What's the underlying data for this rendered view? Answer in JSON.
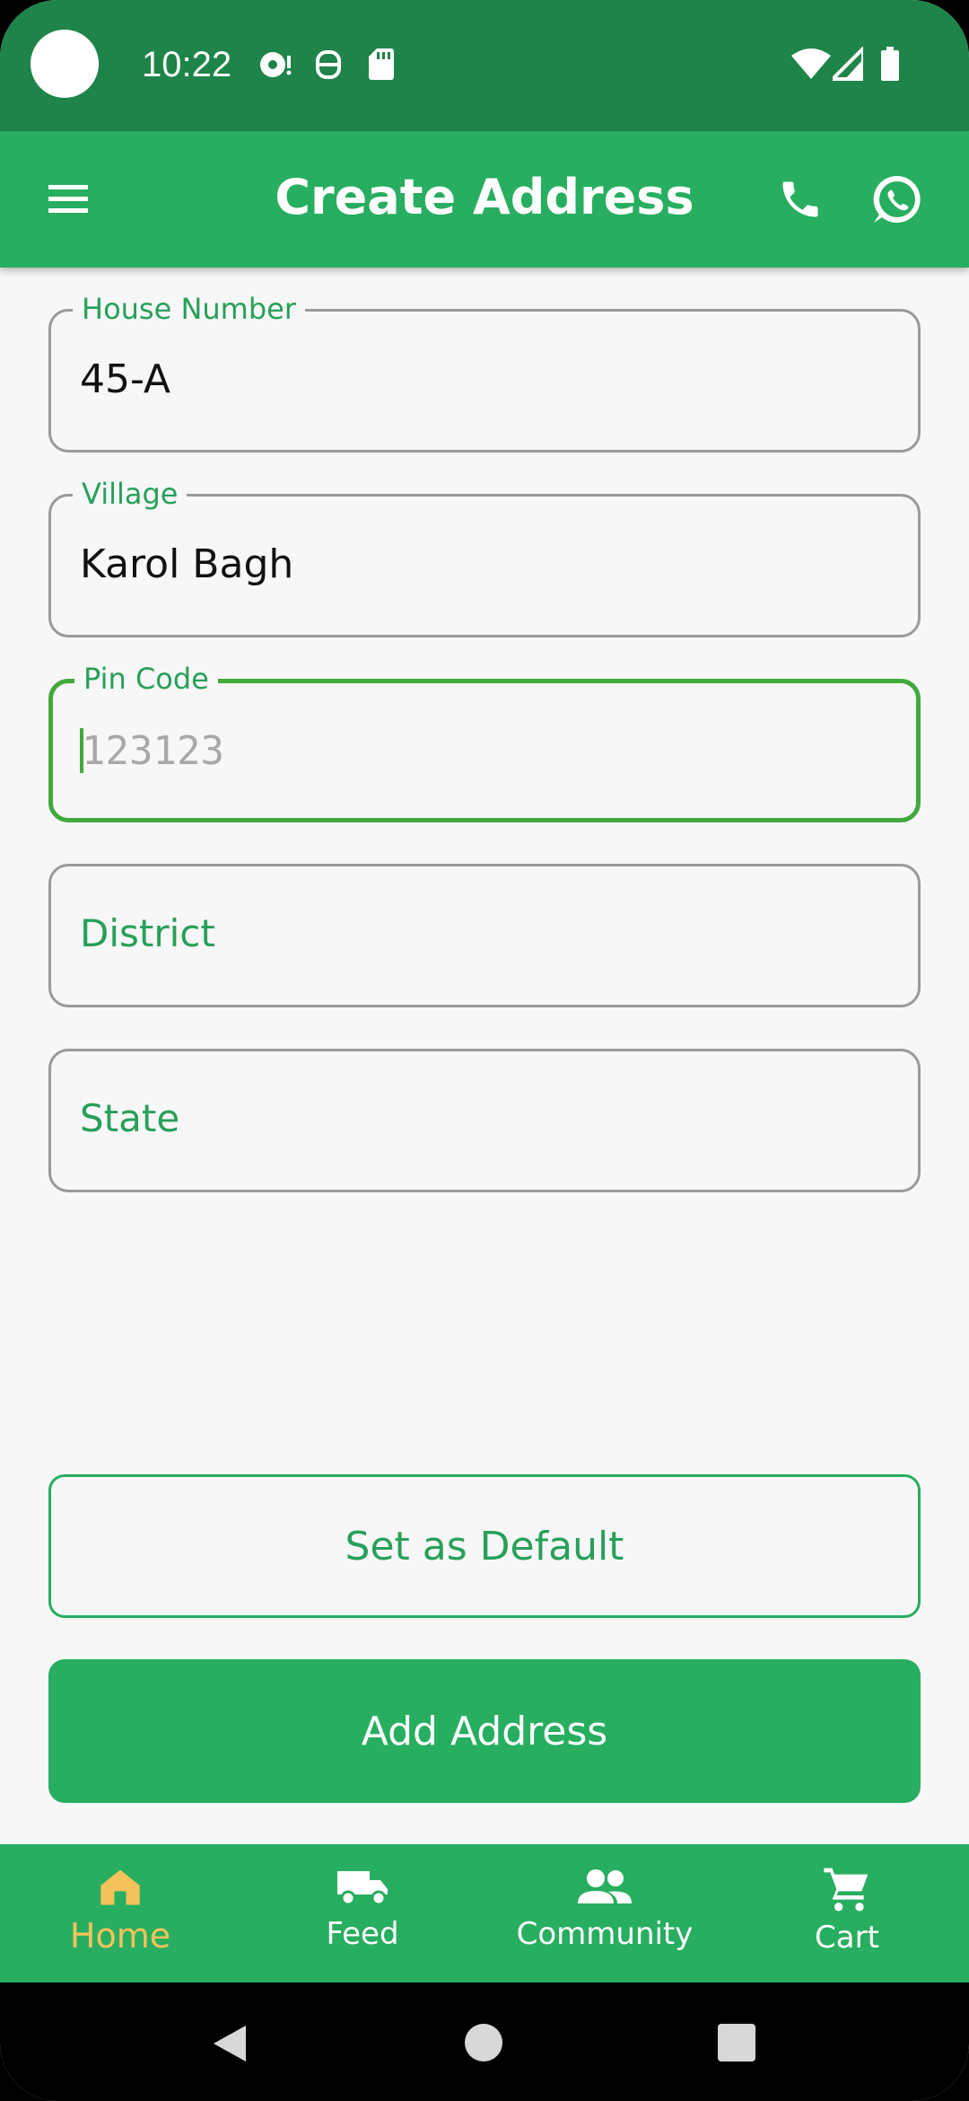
{
  "status_bar": {
    "time": "10:22",
    "icons": [
      "notification-icon",
      "android-icon",
      "sd-card-icon",
      "wifi-icon",
      "signal-icon",
      "battery-icon"
    ]
  },
  "app_bar": {
    "title": "Create Address",
    "icons": [
      "menu-icon",
      "phone-icon",
      "whatsapp-icon"
    ]
  },
  "form": {
    "house_number": {
      "label": "House Number",
      "value": "45-A"
    },
    "village": {
      "label": "Village",
      "value": "Karol Bagh"
    },
    "pin_code": {
      "label": "Pin Code",
      "placeholder": "123123"
    },
    "district": {
      "label": "District"
    },
    "state": {
      "label": "State"
    }
  },
  "buttons": {
    "set_default": "Set as Default",
    "add_address": "Add Address"
  },
  "bottom_nav": {
    "items": [
      {
        "label": "Home",
        "icon": "home-icon",
        "active": true
      },
      {
        "label": "Feed",
        "icon": "truck-icon",
        "active": false
      },
      {
        "label": "Community",
        "icon": "people-icon",
        "active": false
      },
      {
        "label": "Cart",
        "icon": "cart-icon",
        "active": false
      }
    ]
  },
  "colors": {
    "primary": "#27ae60",
    "status_bar": "#1e8449",
    "focus": "#43a83c",
    "active_nav": "#f6c25b"
  }
}
